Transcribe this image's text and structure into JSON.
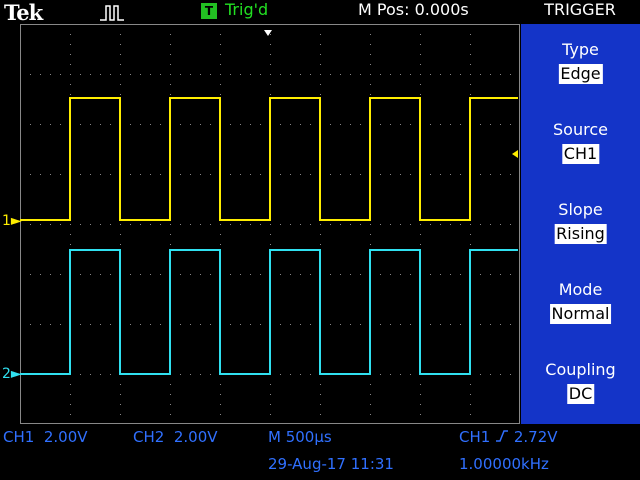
{
  "header": {
    "brand": "Tek",
    "acquire_icon": "pulse-waveform-icon",
    "trigger_badge": "T",
    "trigger_status": "Trig'd",
    "position_readout": "M Pos: 0.000s",
    "menu_title": "TRIGGER"
  },
  "menu": [
    {
      "label": "Type",
      "value": "Edge"
    },
    {
      "label": "Source",
      "value": "CH1"
    },
    {
      "label": "Slope",
      "value": "Rising"
    },
    {
      "label": "Mode",
      "value": "Normal"
    },
    {
      "label": "Coupling",
      "value": "DC"
    }
  ],
  "channels": {
    "ch1_marker": "1",
    "ch2_marker": "2",
    "ch1_color": "#ffee00",
    "ch2_color": "#30e0f0"
  },
  "status": {
    "ch1_label": "CH1",
    "ch1_scale": "2.00V",
    "ch2_label": "CH2",
    "ch2_scale": "2.00V",
    "timebase": "M 500µs",
    "trigger_source": "CH1",
    "trigger_slope_icon": "rising-edge-icon",
    "trigger_level": "2.72V",
    "date": "29-Aug-17 11:31",
    "frequency": "1.00000kHz"
  },
  "colors": {
    "menu_background": "#1434c8",
    "readout_blue": "#3070ff",
    "trigger_green": "#22e022"
  }
}
